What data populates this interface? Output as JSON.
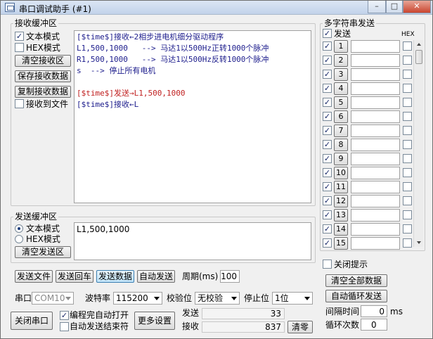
{
  "window": {
    "title": "串口调试助手 (#1)",
    "min_glyph": "–",
    "max_glyph": "□",
    "close_glyph": "✕"
  },
  "recv": {
    "group_label": "接收缓冲区",
    "text_mode_label": "文本模式",
    "hex_mode_label": "HEX模式",
    "clear_label": "清空接收区",
    "save_label": "保存接收数据",
    "copy_label": "复制接收数据",
    "to_file_label": "接收到文件",
    "lines": [
      {
        "text": "[$time$]接收←2相步进电机细分驱动程序",
        "color": "#1c1c8c"
      },
      {
        "text": "L1,500,1000   --> 马达1以500Hz正转1000个脉冲",
        "color": "#1c1c8c"
      },
      {
        "text": "R1,500,1000   --> 马达1以500Hz反转1000个脉冲",
        "color": "#1c1c8c"
      },
      {
        "text": "s  --> 停止所有电机",
        "color": "#1c1c8c"
      },
      {
        "text": "",
        "color": "#1c1c8c"
      },
      {
        "text": "[$time$]发送→L1,500,1000",
        "color": "#c02020"
      },
      {
        "text": "[$time$]接收←L",
        "color": "#1c1c8c"
      }
    ]
  },
  "send": {
    "group_label": "发送缓冲区",
    "text_mode_label": "文本模式",
    "hex_mode_label": "HEX模式",
    "clear_label": "清空发送区",
    "content": "L1,500,1000"
  },
  "actions": {
    "send_file": "发送文件",
    "send_enter": "发送回车",
    "send_data": "发送数据",
    "auto_send": "自动发送",
    "period_label": "周期(ms)",
    "period_value": "100"
  },
  "serial": {
    "port_label": "串口",
    "port_value": "COM10",
    "baud_label": "波特率",
    "baud_value": "115200",
    "parity_label": "校验位",
    "parity_value": "无校验",
    "stop_label": "停止位",
    "stop_value": "1位",
    "close_port_label": "关闭串口",
    "auto_open_label": "编程完自动打开",
    "auto_end_label": "自动发送结束符",
    "more_settings_label": "更多设置",
    "sent_label": "发送",
    "sent_count": "33",
    "recv_label": "接收",
    "recv_count": "837",
    "clear_counts_label": "清零"
  },
  "multi": {
    "group_label": "多字符串发送",
    "send_header": "发送",
    "hex_header": "HEX",
    "rows": [
      "1",
      "2",
      "3",
      "4",
      "5",
      "6",
      "7",
      "8",
      "9",
      "10",
      "11",
      "12",
      "13",
      "14",
      "15"
    ],
    "close_tip_label": "关闭提示",
    "clear_all_label": "清空全部数据",
    "auto_loop_label": "自动循环发送",
    "interval_label": "间隔时间",
    "interval_value": "0",
    "interval_unit": "ms",
    "loop_label": "循环次数",
    "loop_value": "0"
  }
}
